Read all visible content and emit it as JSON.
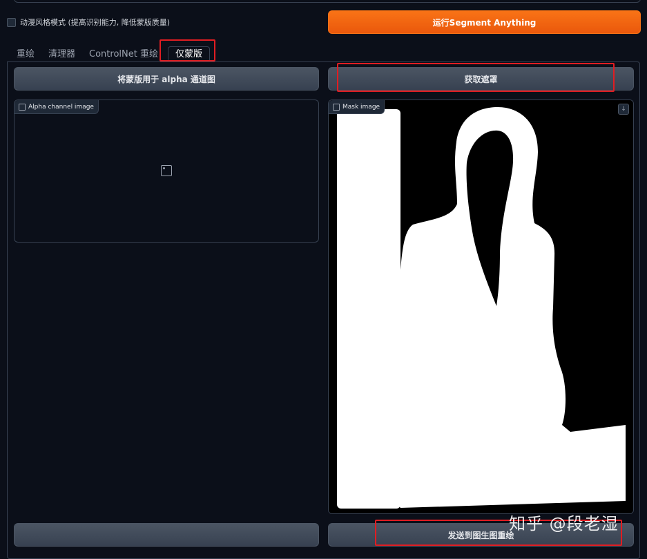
{
  "checkbox": {
    "label": "动漫风格模式 (提高识别能力, 降低蒙版质量)",
    "checked": false
  },
  "run_button": {
    "label": "运行Segment Anything"
  },
  "tabs": [
    {
      "label": "重绘"
    },
    {
      "label": "清理器"
    },
    {
      "label": "ControlNet 重绘"
    },
    {
      "label": "仅蒙版",
      "active": true
    }
  ],
  "left_panel": {
    "button_label": "将蒙版用于 alpha 通道图",
    "image_label": "Alpha channel image",
    "image_icon": "image-icon"
  },
  "right_panel": {
    "button_label": "获取遮罩",
    "image_label": "Mask image",
    "image_icon": "image-icon",
    "download_icon": "download-icon",
    "send_button_label": "发送到图生图重绘"
  },
  "watermark": "知乎 @段老湿",
  "colors": {
    "accent": "#f97316",
    "highlight": "#e11d22",
    "background": "#0b0f19"
  }
}
